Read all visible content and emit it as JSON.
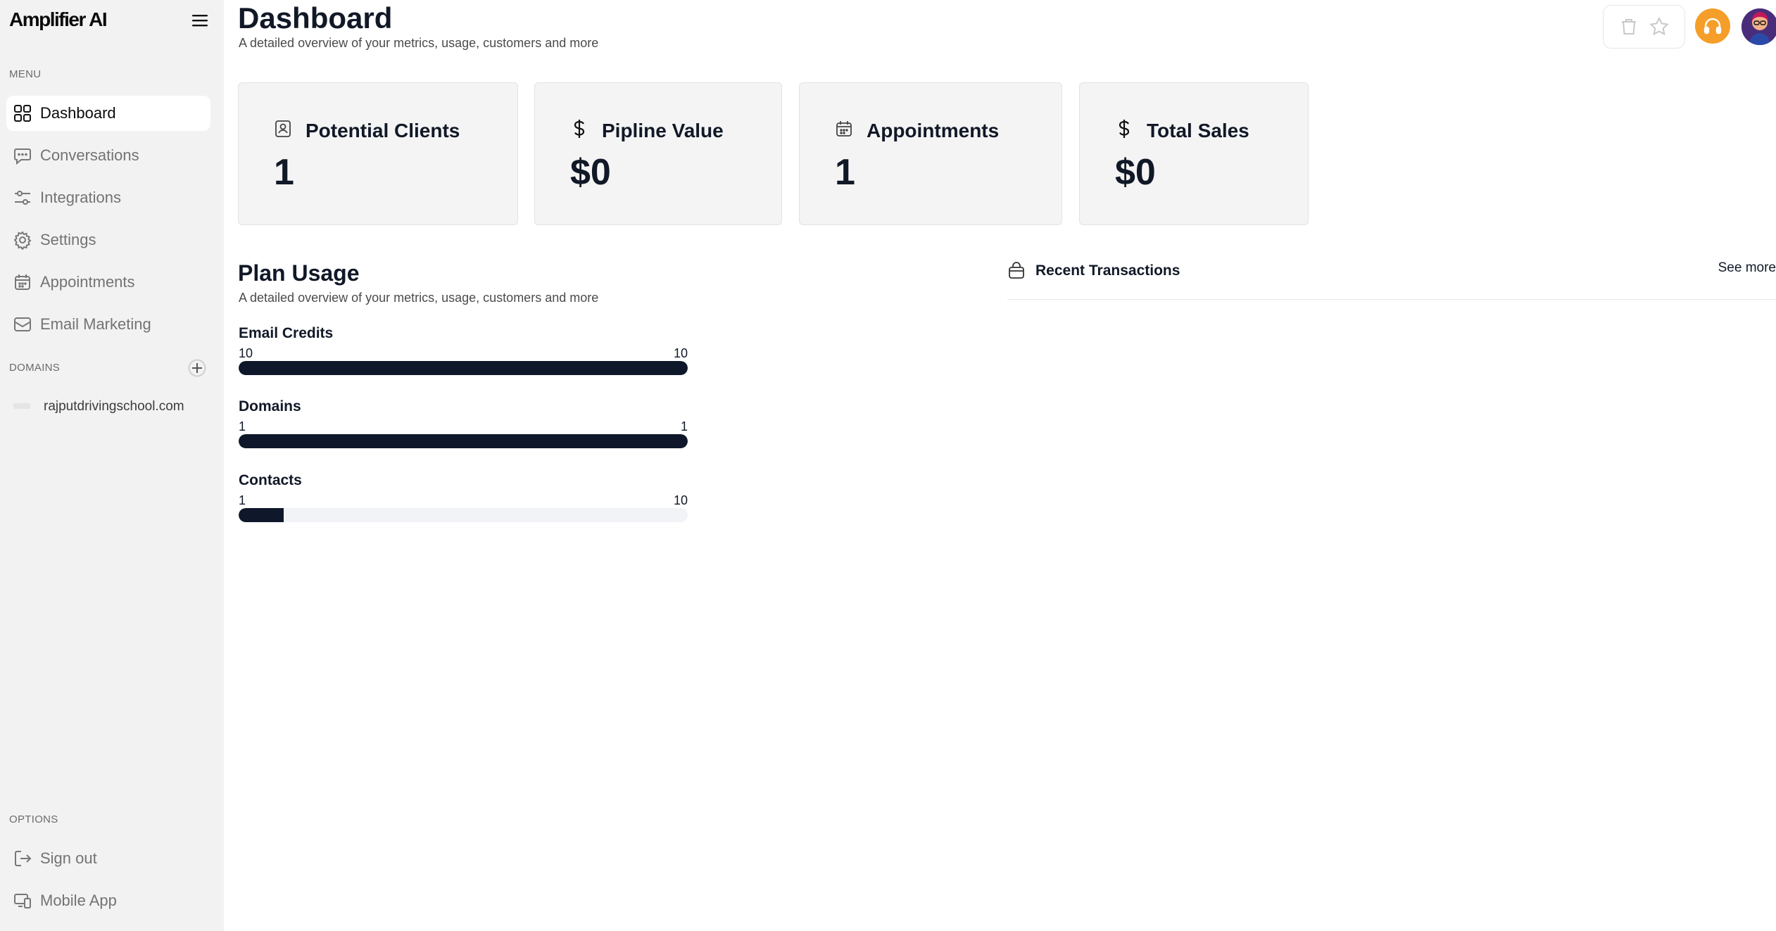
{
  "app": {
    "logo": "Amplifier AI"
  },
  "sidebar": {
    "menu_label": "MENU",
    "items": [
      {
        "label": "Dashboard",
        "icon": "grid-icon",
        "active": true
      },
      {
        "label": "Conversations",
        "icon": "chat-bubble-icon"
      },
      {
        "label": "Integrations",
        "icon": "sliders-icon"
      },
      {
        "label": "Settings",
        "icon": "gear-icon"
      },
      {
        "label": "Appointments",
        "icon": "calendar-icon"
      },
      {
        "label": "Email Marketing",
        "icon": "mail-icon"
      }
    ],
    "domains_label": "DOMAINS",
    "domains": [
      {
        "name": "rajputdrivingschool.com"
      }
    ],
    "options_label": "OPTIONS",
    "options": [
      {
        "label": "Sign out",
        "icon": "sign-out-icon"
      },
      {
        "label": "Mobile App",
        "icon": "devices-icon"
      }
    ]
  },
  "header": {
    "title": "Dashboard",
    "subtitle": "A detailed overview of your metrics, usage, customers and more"
  },
  "stats": [
    {
      "title": "Potential Clients",
      "value": "1",
      "icon": "user-badge-icon"
    },
    {
      "title": "Pipline Value",
      "value": "$0",
      "icon": "dollar-icon"
    },
    {
      "title": "Appointments",
      "value": "1",
      "icon": "calendar-icon"
    },
    {
      "title": "Total Sales",
      "value": "$0",
      "icon": "dollar-icon"
    }
  ],
  "plan_usage": {
    "title": "Plan Usage",
    "subtitle": "A detailed overview of your metrics, usage, customers and more",
    "items": [
      {
        "label": "Email Credits",
        "used": "10",
        "limit": "10",
        "fraction": 1.0
      },
      {
        "label": "Domains",
        "used": "1",
        "limit": "1",
        "fraction": 1.0
      },
      {
        "label": "Contacts",
        "used": "1",
        "limit": "10",
        "fraction": 0.1
      }
    ]
  },
  "recent_transactions": {
    "title": "Recent Transactions",
    "see_more": "See more"
  },
  "colors": {
    "sidebar_bg": "#f2f2f2",
    "card_bg": "#f4f4f4",
    "progress_fill": "#0f172a",
    "support_button": "#f59e2a"
  }
}
